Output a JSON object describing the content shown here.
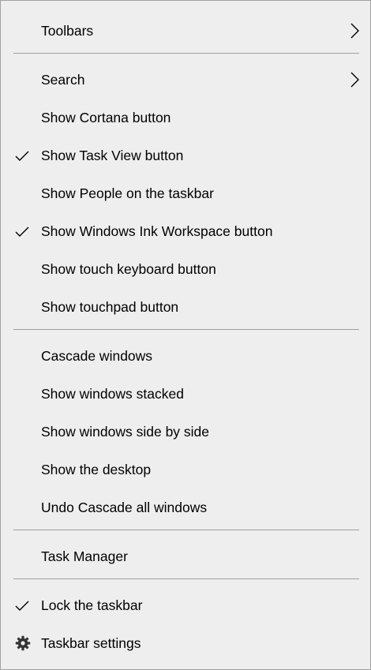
{
  "menu": {
    "toolbars": "Toolbars",
    "search": "Search",
    "show_cortana": "Show Cortana button",
    "show_task_view": "Show Task View button",
    "show_people": "Show People on the taskbar",
    "show_ink_workspace": "Show Windows Ink Workspace button",
    "show_touch_keyboard": "Show touch keyboard button",
    "show_touchpad": "Show touchpad button",
    "cascade_windows": "Cascade windows",
    "show_stacked": "Show windows stacked",
    "show_side_by_side": "Show windows side by side",
    "show_desktop": "Show the desktop",
    "undo_cascade": "Undo Cascade all windows",
    "task_manager": "Task Manager",
    "lock_taskbar": "Lock the taskbar",
    "taskbar_settings": "Taskbar settings"
  },
  "checked": {
    "show_task_view": true,
    "show_ink_workspace": true,
    "lock_taskbar": true
  },
  "icons": {
    "submenu": "chevron-right-icon",
    "checked": "checkmark-icon",
    "settings": "gear-icon"
  },
  "colors": {
    "menu_background": "#eeeeee",
    "separator": "#a0a0a0",
    "text": "#000000"
  }
}
